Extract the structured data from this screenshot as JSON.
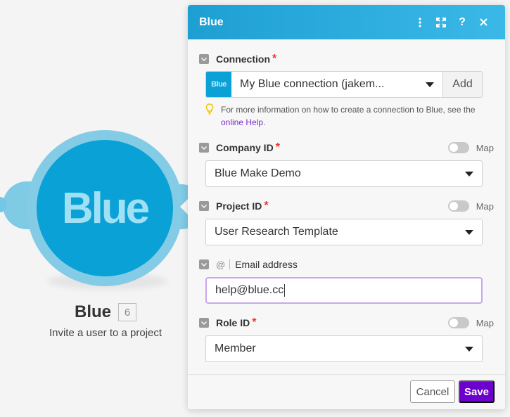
{
  "module": {
    "logo_text": "Blue",
    "title": "Blue",
    "badge": "6",
    "subtitle": "Invite a user to a project",
    "color": "#0aa1d6"
  },
  "panel": {
    "title": "Blue",
    "header_icons": [
      "more-vertical-icon",
      "expand-icon",
      "help-icon",
      "close-icon"
    ]
  },
  "connection": {
    "label": "Connection",
    "required_mark": "*",
    "logo_text": "Blue",
    "value": "My Blue connection (jakem...",
    "add_label": "Add",
    "hint_text": "For more information on how to create a connection to Blue, see the ",
    "hint_link": "online Help",
    "hint_end": "."
  },
  "company": {
    "label": "Company ID",
    "required_mark": "*",
    "map_label": "Map",
    "value": "Blue Make Demo"
  },
  "project": {
    "label": "Project ID",
    "required_mark": "*",
    "map_label": "Map",
    "value": "User Research Template"
  },
  "email": {
    "label": "Email address",
    "type_tag": "@",
    "value": "help@blue.cc"
  },
  "role": {
    "label": "Role ID",
    "required_mark": "*",
    "map_label": "Map",
    "value": "Member"
  },
  "footer": {
    "cancel_label": "Cancel",
    "save_label": "Save"
  },
  "colors": {
    "header_start": "#1e9fd3",
    "header_end": "#3ab9e8",
    "save": "#6d00cc",
    "link": "#7b2fc4",
    "required": "#e53935"
  }
}
